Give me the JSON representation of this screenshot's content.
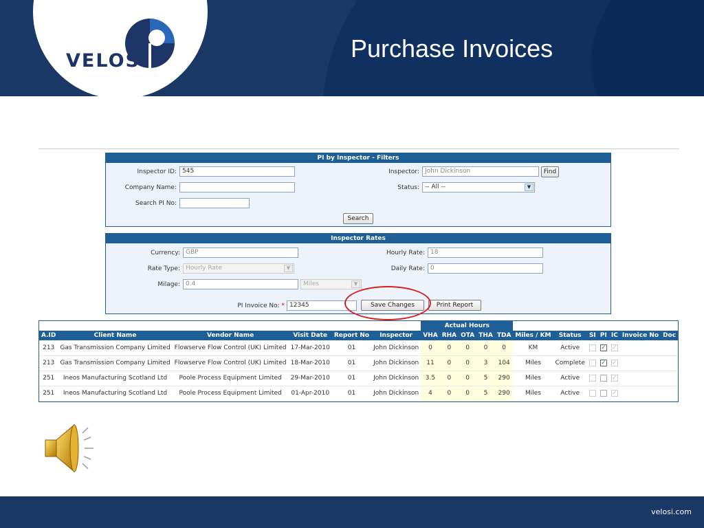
{
  "slide": {
    "title": "Purchase Invoices",
    "logo_text": "VELOSI",
    "footer_url": "velosi.com"
  },
  "filters": {
    "heading": "PI by Inspector - Filters",
    "inspector_id_label": "Inspector ID:",
    "inspector_id_value": "545",
    "inspector_label": "Inspector:",
    "inspector_value": "John Dickinson",
    "find_button": "Find",
    "company_label": "Company Name:",
    "company_value": "",
    "status_label": "Status:",
    "status_value": "-- All --",
    "search_pi_label": "Search PI No:",
    "search_pi_value": "",
    "search_button": "Search"
  },
  "rates": {
    "heading": "Inspector Rates",
    "currency_label": "Currency:",
    "currency_value": "GBP",
    "hourly_label": "Hourly Rate:",
    "hourly_value": "18",
    "rate_type_label": "Rate Type:",
    "rate_type_value": "Hourly Rate",
    "daily_label": "Daily Rate:",
    "daily_value": "0",
    "milage_label": "Milage:",
    "milage_value": "0.4",
    "milage_unit": "Miles",
    "pi_invoice_label": "PI Invoice No:",
    "pi_invoice_req": "*",
    "pi_invoice_value": "12345",
    "save_button": "Save Changes",
    "print_button": "Print Report"
  },
  "grid": {
    "group_header": "Actual Hours",
    "columns": [
      "A.ID",
      "Client Name",
      "Vendor Name",
      "Visit Date",
      "Report No",
      "Inspector",
      "VHA",
      "RHA",
      "OTA",
      "THA",
      "TDA",
      "Miles / KM",
      "Status",
      "SI",
      "PI",
      "IC",
      "Invoice No",
      "Doc"
    ],
    "rows": [
      {
        "aid": "213",
        "client": "Gas Transmission Company Limited",
        "vendor": "Flowserve Flow Control (UK) Limited",
        "date": "17-Mar-2010",
        "report": "01",
        "inspector": "John Dickinson",
        "vha": "0",
        "rha": "0",
        "ota": "0",
        "tha": "0",
        "tda": "0",
        "miles": "KM",
        "status": "Active",
        "si": false,
        "pi": true,
        "ic": true
      },
      {
        "aid": "213",
        "client": "Gas Transmission Company Limited",
        "vendor": "Flowserve Flow Control (UK) Limited",
        "date": "18-Mar-2010",
        "report": "01",
        "inspector": "John Dickinson",
        "vha": "11",
        "rha": "0",
        "ota": "0",
        "tha": "3",
        "tda": "104",
        "miles": "Miles",
        "status": "Complete",
        "si": false,
        "pi": true,
        "ic": true
      },
      {
        "aid": "251",
        "client": "Ineos Manufacturing Scotland Ltd",
        "vendor": "Poole Process Equipment Limited",
        "date": "29-Mar-2010",
        "report": "01",
        "inspector": "John Dickinson",
        "vha": "3.5",
        "rha": "0",
        "ota": "0",
        "tha": "5",
        "tda": "290",
        "miles": "Miles",
        "status": "Active",
        "si": false,
        "pi": false,
        "ic": true
      },
      {
        "aid": "251",
        "client": "Ineos Manufacturing Scotland Ltd",
        "vendor": "Poole Process Equipment Limited",
        "date": "01-Apr-2010",
        "report": "01",
        "inspector": "John Dickinson",
        "vha": "4",
        "rha": "0",
        "ota": "0",
        "tha": "5",
        "tda": "290",
        "miles": "Miles",
        "status": "Active",
        "si": false,
        "pi": false,
        "ic": true
      }
    ]
  },
  "colors": {
    "brand_navy": "#1a3866",
    "panel_header": "#1f5f98",
    "highlight_circle": "#d42020"
  },
  "icons": {
    "speaker": "speaker-icon",
    "logo": "velosi-logo-icon",
    "dropdown": "chevron-down-icon"
  }
}
